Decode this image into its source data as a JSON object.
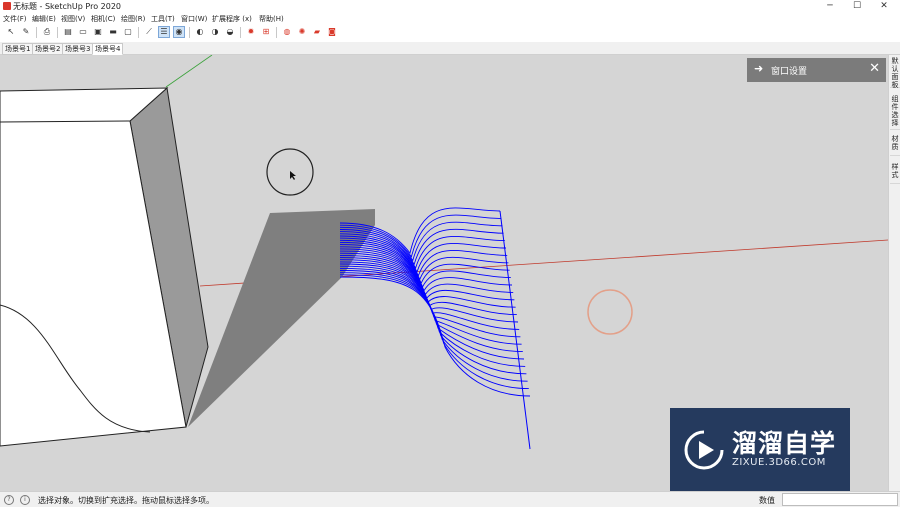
{
  "window": {
    "title": "无标题 - SketchUp Pro 2020",
    "controls": {
      "minimize": "─",
      "maximize": "☐",
      "close": "✕"
    }
  },
  "menu": [
    "文件(F)",
    "编辑(E)",
    "视图(V)",
    "相机(C)",
    "绘图(R)",
    "工具(T)",
    "窗口(W)",
    "扩展程序 (x)",
    "帮助(H)"
  ],
  "toolbar": {
    "icons": [
      {
        "name": "select-icon",
        "glyph": "↖"
      },
      {
        "name": "paint-icon",
        "glyph": "✎"
      },
      {
        "name": "print-icon",
        "glyph": "⎙"
      },
      {
        "name": "view-iso-icon",
        "glyph": "▤"
      },
      {
        "name": "view-top-icon",
        "glyph": "▭"
      },
      {
        "name": "view-front-icon",
        "glyph": "▣"
      },
      {
        "name": "view-right-icon",
        "glyph": "▬"
      },
      {
        "name": "view-back-icon",
        "glyph": "▢"
      },
      {
        "name": "wire-icon",
        "glyph": "⟋"
      },
      {
        "name": "hidden-line-icon",
        "glyph": "☰"
      },
      {
        "name": "shaded-icon",
        "glyph": "◉"
      },
      {
        "name": "style-1-icon",
        "glyph": "◐"
      },
      {
        "name": "style-2-icon",
        "glyph": "◑"
      },
      {
        "name": "style-3-icon",
        "glyph": "◒"
      },
      {
        "name": "gear-icon",
        "glyph": "✹"
      },
      {
        "name": "component-icon",
        "glyph": "⊞"
      },
      {
        "name": "shadow-icon",
        "glyph": "◍"
      },
      {
        "name": "fog-icon",
        "glyph": "✺"
      },
      {
        "name": "folder-icon",
        "glyph": "▰"
      },
      {
        "name": "camera-icon",
        "glyph": "◙"
      }
    ],
    "colors": {
      "active_bg": "#cfe3f7",
      "accent_red": "#d93a2b"
    }
  },
  "scene_tabs": [
    "场景号1",
    "场景号2",
    "场景号3",
    "场景号4"
  ],
  "active_scene_tab": 3,
  "tray_panel": {
    "label": "窗口设置",
    "arrow": "➜",
    "close": "✕"
  },
  "right_tray_tabs": [
    "默认面板",
    "组件选择",
    "材质",
    "样式"
  ],
  "watermark": {
    "title": "溜溜自学",
    "url": "ZIXUE.3D66.COM"
  },
  "status": {
    "message": "选择对象。切换到扩充选择。拖动鼠标选择多项。",
    "measurement_label": "数值",
    "icons": [
      "geo-icon",
      "info-icon"
    ]
  },
  "colors": {
    "viewport_bg": "#d5d5d5",
    "profile_lines": "#0000ff",
    "red_axis": "#c0392b",
    "green_axis": "#3ba23b",
    "shadow": "#7f7f7f"
  }
}
